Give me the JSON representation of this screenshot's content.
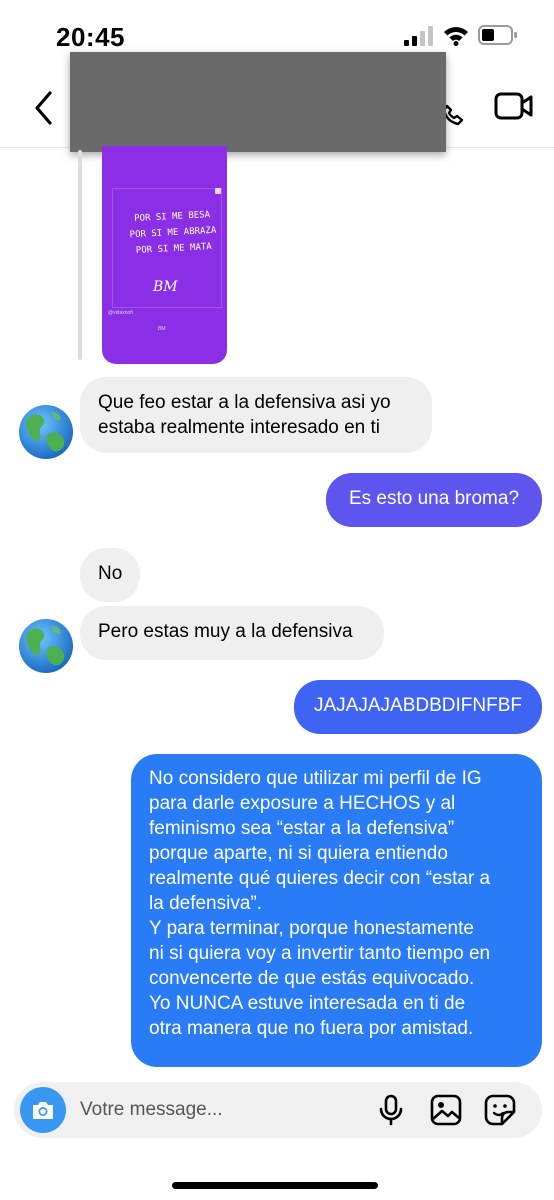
{
  "status_bar": {
    "time": "20:45"
  },
  "story": {
    "handwriting": [
      "POR SI ME BESA",
      "POR SI ME ABRAZA",
      "POR SI ME MATA"
    ],
    "logo": "BM",
    "small_left": "@vidaxnofi",
    "small_center": "BM"
  },
  "messages": [
    {
      "id": "m1",
      "direction": "in",
      "lines": [
        "Que feo estar a la defensiva asi yo",
        "estaba realmente interesado en ti"
      ]
    },
    {
      "id": "m2",
      "direction": "out",
      "lines": [
        "Es esto una broma?"
      ],
      "color": "#5d55ee"
    },
    {
      "id": "m3",
      "direction": "in",
      "lines": [
        "No"
      ]
    },
    {
      "id": "m4",
      "direction": "in",
      "lines": [
        "Pero estas muy a la defensiva"
      ]
    },
    {
      "id": "m5",
      "direction": "out",
      "lines": [
        "JAJAJAJABDBDIFNFBF"
      ],
      "color": "#3f63f2"
    },
    {
      "id": "m6",
      "direction": "out",
      "color": "#2a7bf6",
      "lines": [
        "No considero que utilizar mi perfil de IG",
        "para darle exposure a HECHOS y al",
        "feminismo sea “estar a la defensiva”",
        "porque aparte, ni si quiera entiendo",
        "realmente qué quieres decir con “estar a",
        "la defensiva”.",
        "Y para terminar, porque honestamente",
        "ni si quiera voy a invertir tanto tiempo en",
        "convencerte de que estás equivocado.",
        "Yo NUNCA estuve interesada en ti de",
        "otra manera que no fuera por amistad."
      ]
    }
  ],
  "composer": {
    "placeholder": "Votre message..."
  },
  "colors": {
    "outgoing_top": "#6a4df0",
    "outgoing_bottom": "#2a7bf6",
    "incoming": "#efefef",
    "camera_button": "#3897f0"
  },
  "icons": [
    "back-icon",
    "video-call-icon",
    "camera-icon",
    "microphone-icon",
    "gallery-icon",
    "sticker-icon"
  ]
}
